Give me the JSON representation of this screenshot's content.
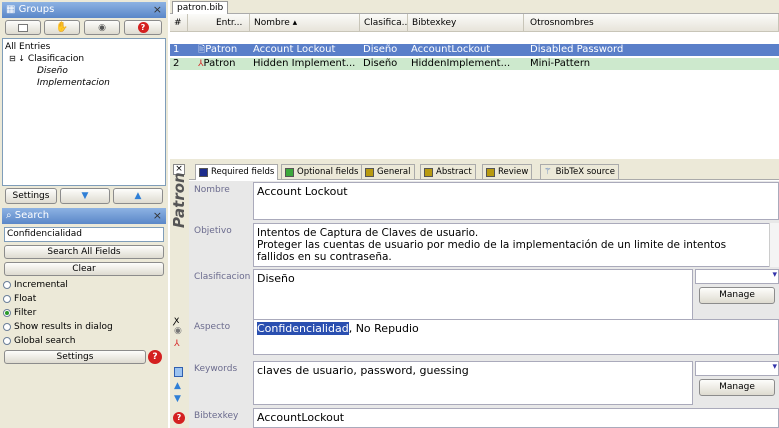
{
  "groups_panel": {
    "title": "Groups",
    "tree": {
      "root": "All Entries",
      "group": "Clasificacion",
      "children": [
        "Diseño",
        "Implementacion"
      ]
    },
    "settings_label": "Settings"
  },
  "search_panel": {
    "title": "Search",
    "query": "Confidencialidad",
    "search_all_label": "Search All Fields",
    "clear_label": "Clear",
    "options": [
      "Incremental",
      "Float",
      "Filter",
      "Show results in dialog",
      "Global search"
    ],
    "selected_option": "Filter",
    "settings_label": "Settings"
  },
  "file_tab": "patron.bib",
  "table": {
    "columns": [
      "#",
      "Entr...",
      "Nombre ▴",
      "Clasifica...",
      "Bibtexkey",
      "Otrosnombres"
    ],
    "rows": [
      {
        "num": "1",
        "type": "Patron",
        "nombre": "Account Lockout",
        "clasificacion": "Diseño",
        "bibtexkey": "AccountLockout",
        "otros": "Disabled Password"
      },
      {
        "num": "2",
        "type": "Patron",
        "nombre": "Hidden Implement...",
        "clasificacion": "Diseño",
        "bibtexkey": "HiddenImplement...",
        "otros": "Mini-Pattern"
      }
    ]
  },
  "editor": {
    "side_label": "Patron",
    "tabs": [
      {
        "label": "Required fields",
        "color": "#1c2c8c"
      },
      {
        "label": "Optional fields",
        "color": "#3ca83c"
      },
      {
        "label": "General",
        "color": "#b89a10"
      },
      {
        "label": "Abstract",
        "color": "#b89a10"
      },
      {
        "label": "Review",
        "color": "#b89a10"
      },
      {
        "label": "BibTeX source",
        "color": ""
      }
    ],
    "fields": {
      "nombre": {
        "label": "Nombre",
        "value": "Account Lockout"
      },
      "objetivo": {
        "label": "Objetivo",
        "line1": "Intentos de Captura de Claves de usuario.",
        "line2": "Proteger las cuentas de usuario por medio de la implementación de un limite de intentos",
        "line3": "fallidos en su contraseña."
      },
      "clasificacion": {
        "label": "Clasificacion",
        "value": "Diseño",
        "manage_label": "Manage"
      },
      "aspecto": {
        "label": "Aspecto",
        "highlight": "Confidencialidad",
        "rest": ", No Repudio"
      },
      "keywords": {
        "label": "Keywords",
        "value": "claves de usuario, password, guessing",
        "manage_label": "Manage"
      },
      "bibtexkey": {
        "label": "Bibtexkey",
        "value": "AccountLockout"
      }
    }
  },
  "colors": {
    "selection": "#5a7fc9",
    "row_highlight": "#cde9cd",
    "title_bar": "#5a87c8"
  }
}
